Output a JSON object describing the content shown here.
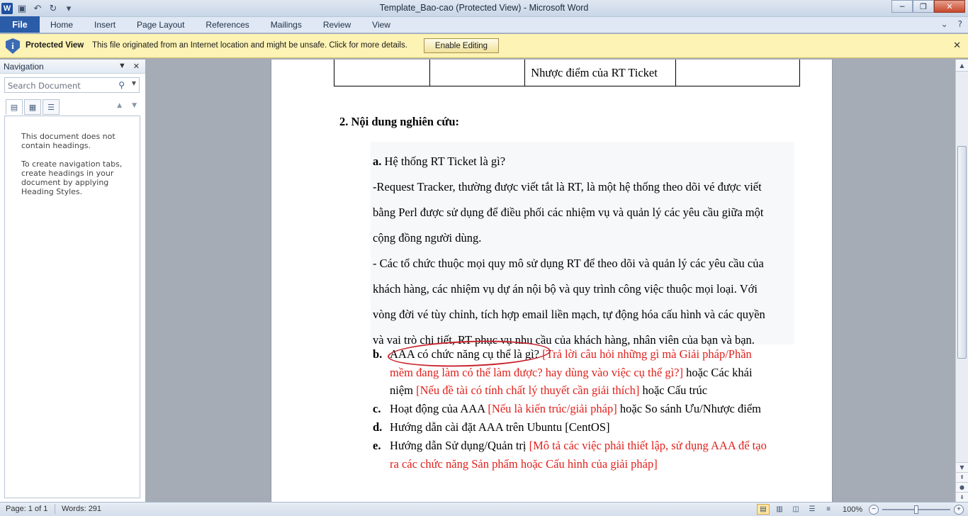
{
  "window": {
    "title": "Template_Bao-cao (Protected View)  -  Microsoft Word",
    "logo_letter": "W",
    "controls": {
      "minimize": "─",
      "maximize": "❐",
      "close": "✕"
    }
  },
  "ribbon": {
    "file_tab": "File",
    "tabs": [
      "Home",
      "Insert",
      "Page Layout",
      "References",
      "Mailings",
      "Review",
      "View"
    ],
    "help_icon": "?"
  },
  "protected_view": {
    "title": "Protected View",
    "message": "This file originated from an Internet location and might be unsafe. Click for more details.",
    "button": "Enable Editing",
    "close": "✕"
  },
  "navigation": {
    "title": "Navigation",
    "search_placeholder": "Search Document",
    "empty_line1": "This document does not contain headings.",
    "empty_line2": "To create navigation tabs, create headings in your document by applying Heading Styles."
  },
  "document": {
    "table_row": [
      "",
      "",
      "Nhược  điểm  của RT  Ticket",
      ""
    ],
    "heading": "2.   Nội  dung  nghiên  cứu:",
    "shaded_lines": [
      {
        "bold": "a.",
        "text": " Hệ thống RT Ticket là gì?"
      },
      {
        "bold": "",
        "text": "-Request Tracker, thường được viết tắt là RT,  là một hệ thống theo dõi vé được viết"
      },
      {
        "bold": "",
        "text": "bằng Perl được sử dụng để điều phối các nhiệm vụ và quản lý các yêu cầu giữa một"
      },
      {
        "bold": "",
        "text": "cộng đồng người dùng."
      },
      {
        "bold": "",
        "text": "- Các tổ chức thuộc mọi quy mô sử dụng RT để theo dõi và quản lý các yêu cầu của"
      },
      {
        "bold": "",
        "text": "khách hàng, các nhiệm vụ dự án nội bộ và quy trình công việc thuộc mọi loại. Với"
      },
      {
        "bold": "",
        "text": "vòng đời vé tùy chỉnh, tích hợp email liền mạch, tự động hóa cấu hình và các quyền"
      },
      {
        "bold": "",
        "text": "và vai trò chi tiết, RT phục vụ nhu cầu của khách hàng, nhân viên của bạn và bạn."
      }
    ],
    "items": [
      {
        "label": "b.",
        "lines": [
          [
            {
              "t": "AAA có chức năng cụ thể là gì?",
              "red": false
            },
            {
              "t": " [Trả lời câu hỏi những gì mà Giải pháp/Phần",
              "red": true
            }
          ],
          [
            {
              "t": "mềm đang làm có thể làm được? hay dùng vào việc cụ thể gì?]",
              "red": true
            },
            {
              "t": " hoặc Các khái",
              "red": false
            }
          ],
          [
            {
              "t": "niệm ",
              "red": false
            },
            {
              "t": "[Nếu đề tài có tính chất lý thuyết cần giải thích]",
              "red": true
            },
            {
              "t": " hoặc Cấu trúc",
              "red": false
            }
          ]
        ]
      },
      {
        "label": "c.",
        "lines": [
          [
            {
              "t": "Hoạt động của AAA ",
              "red": false
            },
            {
              "t": "[Nếu là kiến trúc/giải pháp]",
              "red": true
            },
            {
              "t": " hoặc So sánh Ưu/Nhược điểm",
              "red": false
            }
          ]
        ]
      },
      {
        "label": "d.",
        "lines": [
          [
            {
              "t": "Hướng dẫn cài đặt AAA  trên Ubuntu [CentOS]",
              "red": false
            }
          ]
        ]
      },
      {
        "label": "e.",
        "lines": [
          [
            {
              "t": "Hướng dẫn Sử dụng/Quản trị ",
              "red": false
            },
            {
              "t": "[Mô tả các việc phải thiết lập, sử dụng AAA để tạo",
              "red": true
            }
          ],
          [
            {
              "t": "ra các chức năng Sản phẩm hoặc Cấu hình của giải pháp]",
              "red": true
            }
          ]
        ]
      }
    ]
  },
  "status": {
    "page": "Page: 1 of 1",
    "words": "Words: 291",
    "zoom": "100%",
    "zoom_fraction": 0.5
  },
  "colors": {
    "accent": "#2a5ca8",
    "annotation_red": "#e0201b",
    "warning_bar": "#fdf3b4"
  }
}
